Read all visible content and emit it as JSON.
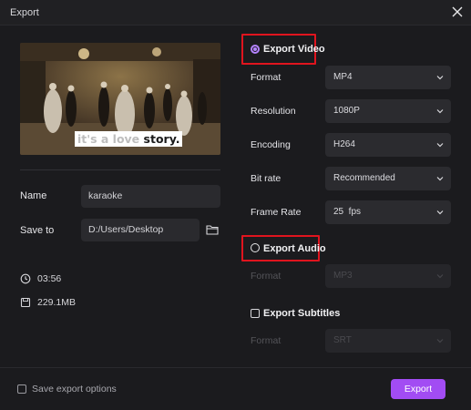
{
  "window": {
    "title": "Export"
  },
  "preview": {
    "caption_dim": "it's a love",
    "caption_bold": "story."
  },
  "left": {
    "name_label": "Name",
    "name_value": "karaoke",
    "save_to_label": "Save to",
    "save_to_value": "D:/Users/Desktop",
    "duration": "03:56",
    "size": "229.1MB"
  },
  "export_video": {
    "label": "Export Video",
    "checked": true,
    "rows": [
      {
        "label": "Format",
        "value": "MP4"
      },
      {
        "label": "Resolution",
        "value": "1080P"
      },
      {
        "label": "Encoding",
        "value": "H264"
      },
      {
        "label": "Bit rate",
        "value": "Recommended"
      },
      {
        "label": "Frame Rate",
        "value": "25  fps"
      }
    ]
  },
  "export_audio": {
    "label": "Export Audio",
    "checked": false,
    "format_label": "Format",
    "format_value": "MP3"
  },
  "export_subtitles": {
    "label": "Export Subtitles",
    "checked": false,
    "format_label": "Format",
    "format_value": "SRT"
  },
  "footer": {
    "save_options_label": "Save export options",
    "export_button": "Export"
  },
  "colors": {
    "accent": "#a24cf3",
    "radio_accent": "#b483ff",
    "highlight": "#e0141e",
    "background": "#1b1b1e"
  }
}
